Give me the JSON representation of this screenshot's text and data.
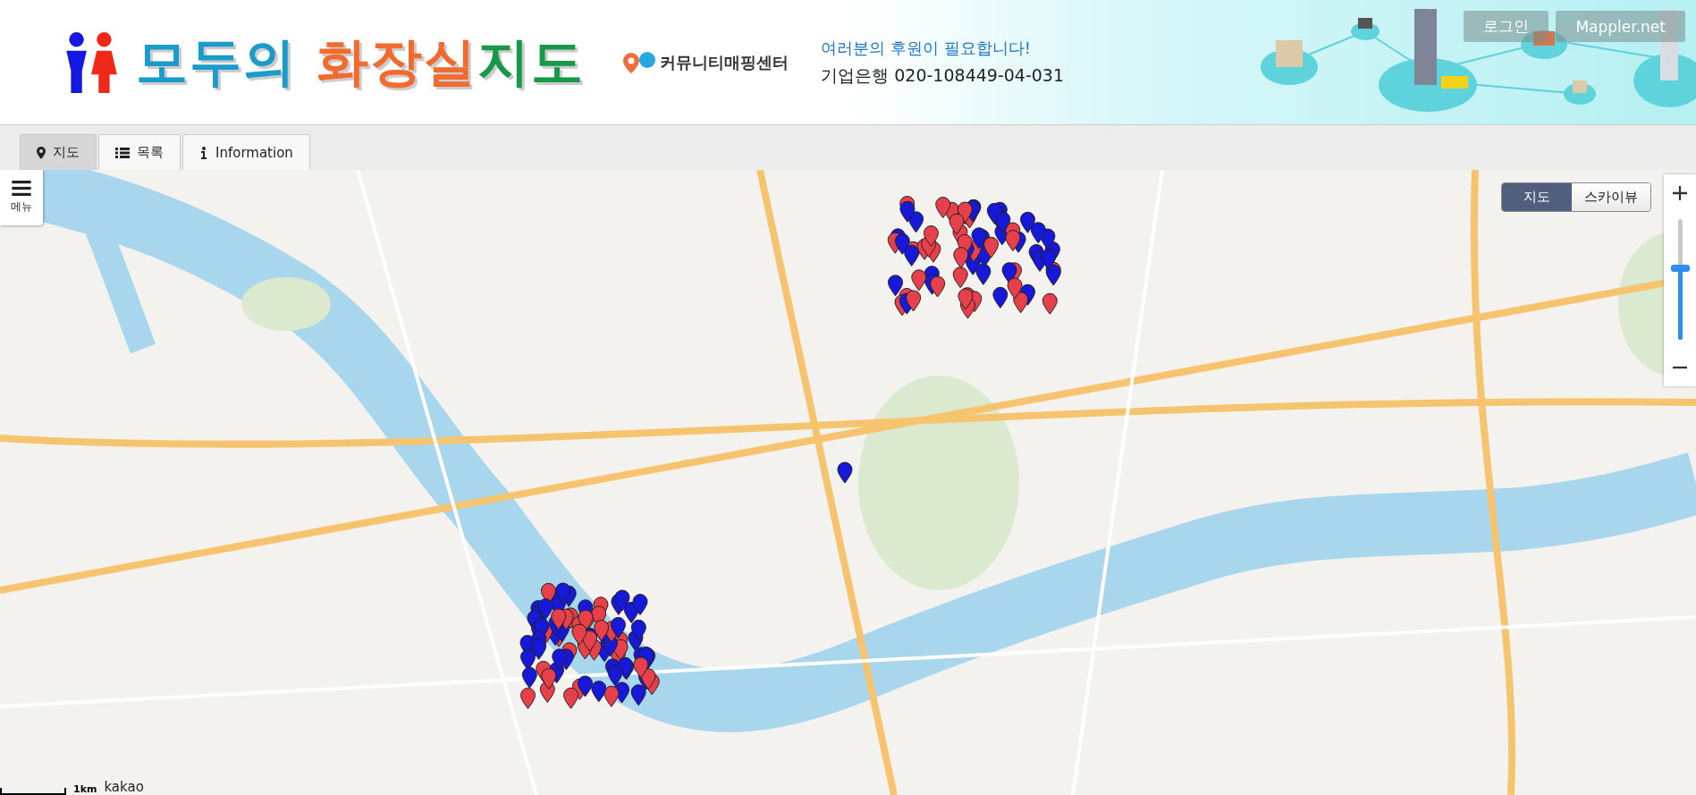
{
  "header": {
    "logo_parts": [
      "모두의",
      "화장실",
      "지도"
    ],
    "partner": "커뮤니티매핑센터",
    "donation": "여러분의 후원이 필요합니다!",
    "account": "기업은행 020-108449-04-031",
    "buttons": [
      "로그인",
      "Mappler.net"
    ]
  },
  "tabs": [
    {
      "label": "지도",
      "kind": "map",
      "selected": true
    },
    {
      "label": "목록",
      "kind": "list",
      "selected": false
    },
    {
      "label": "Information",
      "kind": "info",
      "selected": false
    }
  ],
  "map": {
    "menu_label": "메뉴",
    "view_types": [
      {
        "label": "지도",
        "selected": true
      },
      {
        "label": "스카이뷰",
        "selected": false
      }
    ],
    "zoom": {
      "level": 0.6
    },
    "scale": "1km",
    "attribution": "kakao"
  }
}
